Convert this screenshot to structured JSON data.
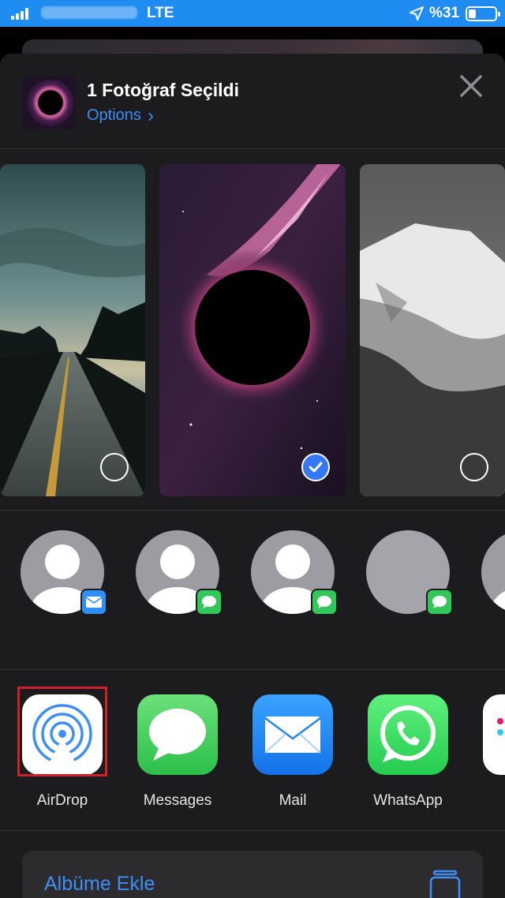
{
  "status_bar": {
    "network": "LTE",
    "battery_text": "%31",
    "signal_bars": 4,
    "icons": [
      "signal-icon",
      "location-icon",
      "battery-icon"
    ]
  },
  "share_sheet": {
    "title": "1 Fotoğraf Seçildi",
    "options_label": "Options",
    "options_chevron": "›",
    "close_icon": "close-icon",
    "photos": [
      {
        "name": "road-photo",
        "selected": false
      },
      {
        "name": "black-hole-photo",
        "selected": true
      },
      {
        "name": "snowy-mountain-photo",
        "selected": false
      }
    ],
    "people": [
      {
        "badge": "mail-icon"
      },
      {
        "badge": "messages-icon"
      },
      {
        "badge": "messages-icon"
      },
      {
        "badge": "messages-icon"
      }
    ],
    "apps": [
      {
        "label": "AirDrop",
        "icon": "airdrop-icon"
      },
      {
        "label": "Messages",
        "icon": "messages-icon"
      },
      {
        "label": "Mail",
        "icon": "mail-icon"
      },
      {
        "label": "WhatsApp",
        "icon": "whatsapp-icon"
      }
    ],
    "actions": [
      {
        "label": "Albüme Ekle",
        "icon": "add-to-album-icon"
      }
    ]
  },
  "colors": {
    "status_bar": "#1e8cf0",
    "sheet_bg": "#1c1c1e",
    "accent_blue": "#3d8ef7",
    "highlight_red": "#d0212a",
    "messages_green": "#33c75a"
  }
}
